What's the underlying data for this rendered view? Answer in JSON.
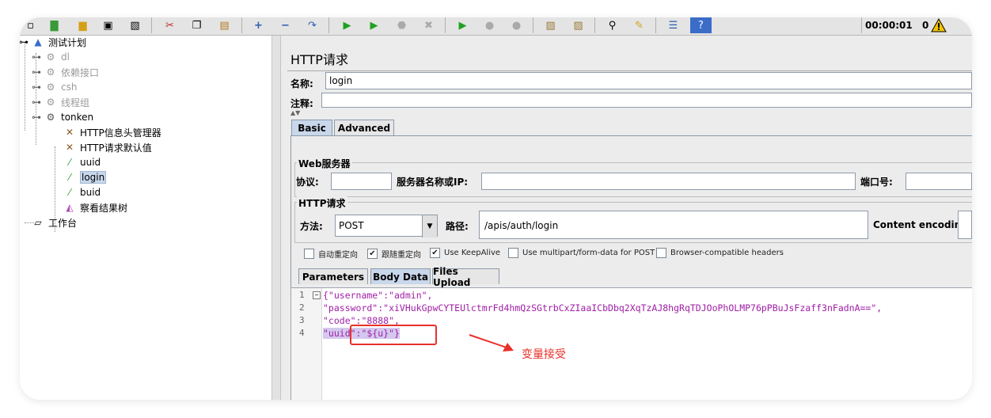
{
  "toolbar": {
    "timer": "00:00:01",
    "error_count": "0",
    "icons": [
      "new-icon",
      "templates-icon",
      "open-icon",
      "save-icon",
      "save-as-icon",
      "cut-icon",
      "copy-icon",
      "paste-icon",
      "expand-icon",
      "collapse-icon",
      "toggle-icon",
      "start-icon",
      "start-no-pause-icon",
      "stop-icon",
      "shutdown-icon",
      "remote-start-icon",
      "remote-stop-icon",
      "remote-shutdown-icon",
      "clear-icon",
      "clear-all-icon",
      "search-icon",
      "reset-search-icon",
      "function-helper-icon",
      "help-icon"
    ]
  },
  "tree": {
    "root": "测试计划",
    "items": [
      {
        "label": "dl",
        "disabled": true
      },
      {
        "label": "依赖接口",
        "disabled": true
      },
      {
        "label": "csh",
        "disabled": true
      },
      {
        "label": "线程组",
        "disabled": true
      },
      {
        "label": "tonken",
        "disabled": false
      }
    ],
    "children": [
      {
        "label": "HTTP信息头管理器"
      },
      {
        "label": "HTTP请求默认值"
      },
      {
        "label": "uuid"
      },
      {
        "label": "login",
        "selected": true
      },
      {
        "label": "buid"
      },
      {
        "label": "察看结果树"
      }
    ],
    "workbench": "工作台"
  },
  "panel": {
    "title": "HTTP请求",
    "name_label": "名称:",
    "name_value": "login",
    "comment_label": "注释:",
    "comment_value": "",
    "tabs": [
      "Basic",
      "Advanced"
    ],
    "web_server": {
      "group_title": "Web服务器",
      "protocol_label": "协议:",
      "protocol_value": "",
      "server_label": "服务器名称或IP:",
      "server_value": "",
      "port_label": "端口号:",
      "port_value": ""
    },
    "http_request": {
      "group_title": "HTTP请求",
      "method_label": "方法:",
      "method_value": "POST",
      "path_label": "路径:",
      "path_value": "/apis/auth/login",
      "encoding_label": "Content encoding:",
      "encoding_value": ""
    },
    "checkboxes": [
      {
        "label": "自动重定向",
        "checked": false
      },
      {
        "label": "跟随重定向",
        "checked": true
      },
      {
        "label": "Use KeepAlive",
        "checked": true
      },
      {
        "label": "Use multipart/form-data for POST",
        "checked": false
      },
      {
        "label": "Browser-compatible headers",
        "checked": false
      }
    ],
    "subtabs": [
      "Parameters",
      "Body Data",
      "Files Upload"
    ],
    "body_lines": [
      {
        "num": "1",
        "text": "{\"username\":\"admin\","
      },
      {
        "num": "2",
        "text": "\"password\":\"xiVHukGpwCYTEUlctmrFd4hmQzSGtrbCxZIaaICbDbq2XqTzAJ8hgRqTDJOoPhOLMP76pPBuJsFzaff3nFadnA==\","
      },
      {
        "num": "3",
        "text": "\"code\":\"8888\","
      },
      {
        "num": "4",
        "text": "\"uuid\":\"${u}\"}"
      }
    ]
  },
  "annotation": {
    "text": "变量接受",
    "color": "#e8312a"
  }
}
